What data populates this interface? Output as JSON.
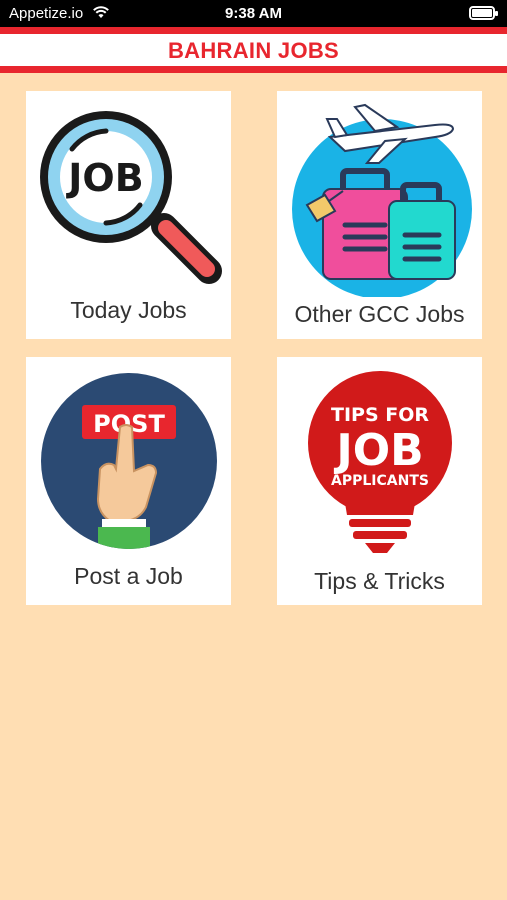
{
  "status_bar": {
    "carrier": "Appetize.io",
    "time": "9:38 AM"
  },
  "header": {
    "title": "BAHRAIN JOBS"
  },
  "tiles": [
    {
      "label": "Today Jobs",
      "icon": "magnifier-job-icon",
      "icon_text": "JOB"
    },
    {
      "label": "Other GCC Jobs",
      "icon": "airplane-luggage-icon"
    },
    {
      "label": "Post a Job",
      "icon": "post-hand-icon",
      "icon_text": "POST"
    },
    {
      "label": "Tips & Tricks",
      "icon": "tips-bulb-icon",
      "icon_text_1": "TIPS FOR",
      "icon_text_2": "JOB",
      "icon_text_3": "APPLICANTS"
    }
  ],
  "colors": {
    "background": "#ffdeb3",
    "accent": "#e8262e",
    "tile": "#ffffff"
  }
}
